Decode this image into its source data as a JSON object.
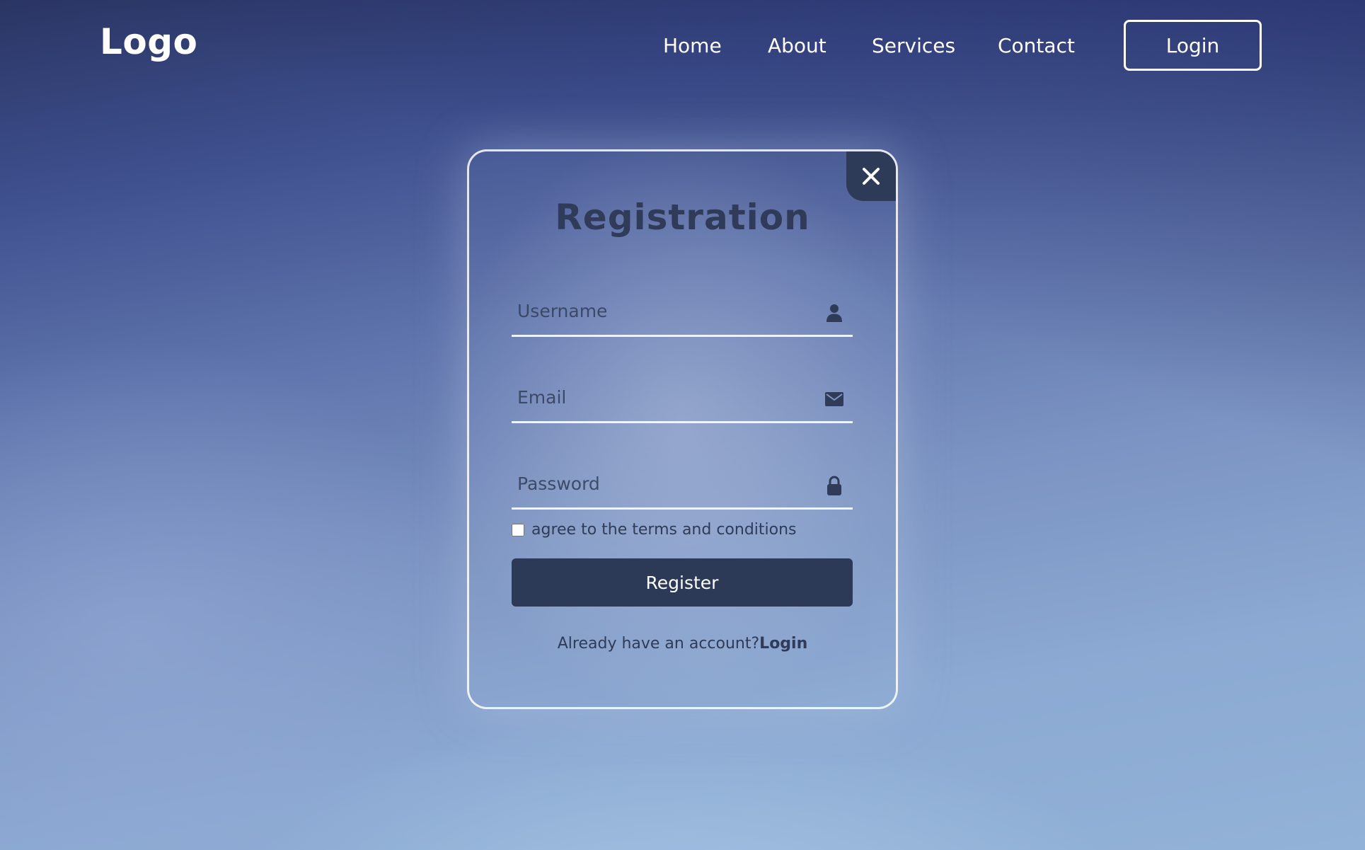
{
  "header": {
    "logo": "Logo",
    "nav": {
      "home": "Home",
      "about": "About",
      "services": "Services",
      "contact": "Contact"
    },
    "login_button": "Login"
  },
  "modal": {
    "title": "Registration",
    "close_icon": "close-icon",
    "fields": {
      "username": {
        "placeholder": "Username",
        "value": "",
        "icon": "user-icon"
      },
      "email": {
        "placeholder": "Email",
        "value": "",
        "icon": "envelope-icon"
      },
      "password": {
        "placeholder": "Password",
        "value": "",
        "icon": "lock-icon"
      }
    },
    "terms_label": "agree to the terms and conditions",
    "terms_checked": false,
    "register_button": "Register",
    "account_prompt": "Already have an account?",
    "login_link": "Login"
  },
  "colors": {
    "card_dark": "#2d3a57",
    "text_dark": "#2f3b58",
    "white": "#ffffff"
  }
}
